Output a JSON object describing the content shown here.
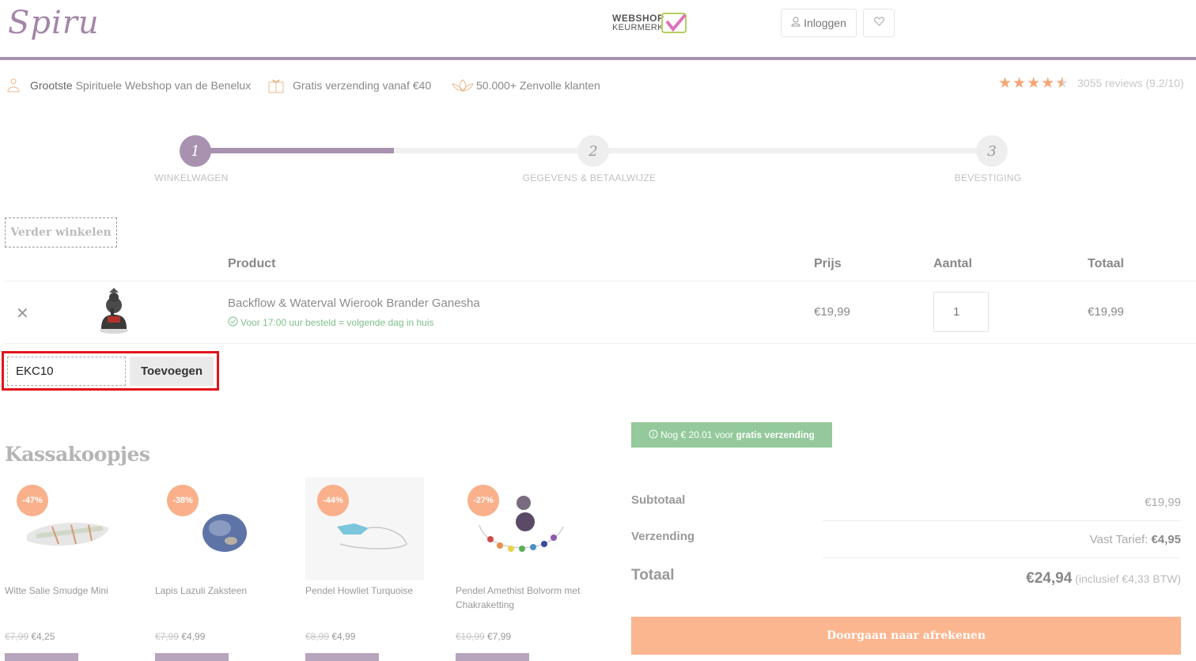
{
  "header": {
    "logo": "Spiru",
    "keurmerk_line1": "WEBSHOP",
    "keurmerk_line2": "KEURMERK",
    "login_label": "Inloggen"
  },
  "usps": [
    {
      "bold": "Grootste",
      "text": " Spirituele Webshop van de Benelux",
      "icon": "buddha-icon"
    },
    {
      "bold": "",
      "text": "Gratis verzending vanaf €40",
      "icon": "gift-icon"
    },
    {
      "bold": "",
      "text": "50.000+ Zenvolle klanten",
      "icon": "lotus-icon"
    }
  ],
  "rating": {
    "stars": 4.5,
    "text": "3055 reviews (9.2/10)"
  },
  "steps": [
    {
      "number": "1",
      "label": "WINKELWAGEN",
      "active": true
    },
    {
      "number": "2",
      "label": "GEGEVENS & BETAALWIJZE",
      "active": false
    },
    {
      "number": "3",
      "label": "BEVESTIGING",
      "active": false
    }
  ],
  "progress_fraction": 0.25,
  "continue_label": "Verder winkelen",
  "cart": {
    "headers": {
      "product": "Product",
      "price": "Prijs",
      "quantity": "Aantal",
      "total": "Totaal"
    },
    "items": [
      {
        "name": "Backflow & Waterval Wierook Brander Ganesha",
        "delivery": "Voor 17:00 uur besteld = volgende dag in huis",
        "price": "€19,99",
        "quantity": "1",
        "total": "€19,99"
      }
    ]
  },
  "coupon": {
    "value": "EKC10",
    "button": "Toevoegen"
  },
  "kassakoopjes": {
    "title": "Kassakoopjes",
    "items": [
      {
        "badge": "-47%",
        "name": "Witte Salie Smudge Mini",
        "old_price": "€7,99",
        "price": "€4,25"
      },
      {
        "badge": "-38%",
        "name": "Lapis Lazuli Zaksteen",
        "old_price": "€7,99",
        "price": "€4,99"
      },
      {
        "badge": "-44%",
        "name": "Pendel Howliet Turquoise",
        "old_price": "€8,99",
        "price": "€4,99"
      },
      {
        "badge": "-27%",
        "name": "Pendel Amethist Bolvorm met Chakraketting",
        "old_price": "€10,99",
        "price": "€7,99"
      }
    ]
  },
  "summary": {
    "free_shipping_prefix": "Nog € 20.01 voor ",
    "free_shipping_bold": "gratis verzending",
    "subtotal_label": "Subtotaal",
    "subtotal_value": "€19,99",
    "shipping_label": "Verzending",
    "shipping_prefix": "Vast Tarief: ",
    "shipping_value": "€4,95",
    "total_label": "Totaal",
    "total_value": "€24,94",
    "total_note": " (inclusief €4,33 BTW)",
    "checkout_label": "Doorgaan naar afrekenen"
  },
  "colors": {
    "brand_purple": "#a892b0",
    "accent_orange": "#fbb58f",
    "success_green": "#93c99b",
    "highlight_red": "#e0141b"
  }
}
